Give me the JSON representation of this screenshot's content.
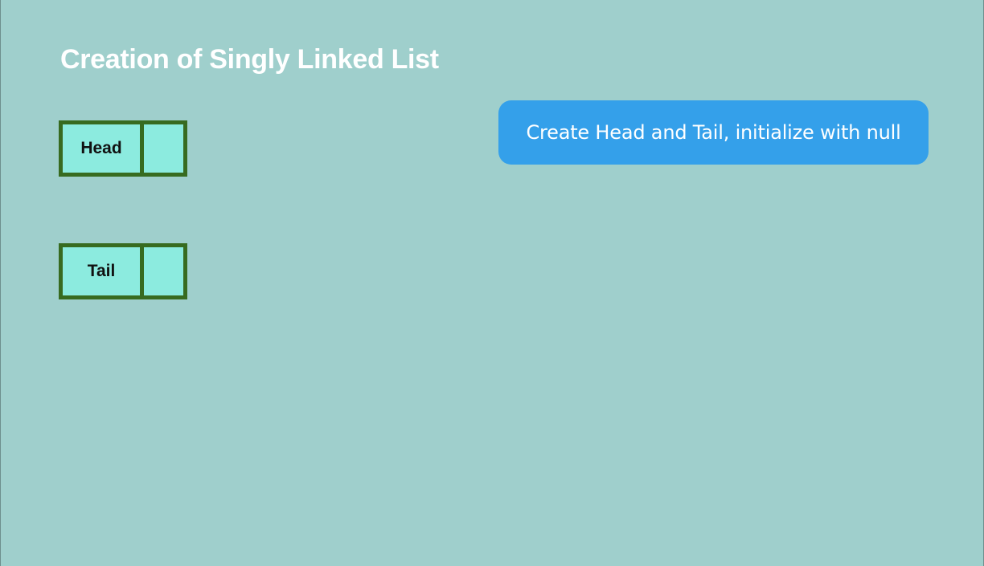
{
  "title": "Creation of Singly Linked List",
  "nodes": {
    "head": {
      "label": "Head"
    },
    "tail": {
      "label": "Tail"
    }
  },
  "callout": {
    "text": "Create Head and Tail, initialize with null"
  },
  "colors": {
    "background": "#9fcfcc",
    "node_fill": "#8cebdf",
    "node_border": "#376b20",
    "callout_fill": "#34a0ea",
    "title_text": "#ffffff"
  }
}
